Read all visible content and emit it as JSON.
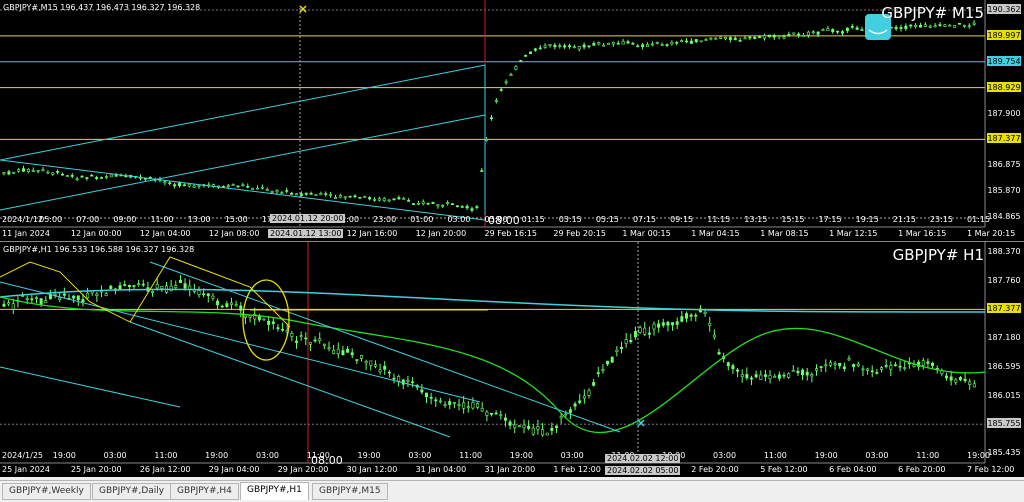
{
  "m15": {
    "info": "GBPJPY#,M15  196.437 196.473 196.327 196.328",
    "symbol": "GBPJPY# M15",
    "price_labels": [
      {
        "text": "190.362",
        "kind": "gray"
      },
      {
        "text": "189.997",
        "kind": "yellow"
      },
      {
        "text": "189.754",
        "kind": "cyan"
      },
      {
        "text": "188.929",
        "kind": "yellow"
      },
      {
        "text": "187.900",
        "kind": "plain"
      },
      {
        "text": "187.377",
        "kind": "yellow"
      },
      {
        "text": "186.875",
        "kind": "plain"
      },
      {
        "text": "185.870",
        "kind": "plain"
      },
      {
        "text": "184.865",
        "kind": "plain"
      }
    ],
    "time_labels": [
      "11 Jan 2024",
      "12 Jan 00:00",
      "12 Jan 04:00",
      "12 Jan 08:00",
      "12 Jan 12:00",
      "12 Jan 16:00",
      "12 Jan 20:00",
      "29 Feb 16:15",
      "29 Feb 20:15",
      "1 Mar 00:15",
      "1 Mar 04:15",
      "1 Mar 08:15",
      "1 Mar 12:15",
      "1 Mar 16:15",
      "1 Mar 20:15"
    ],
    "inner_labels": [
      "2024/1/12",
      "05:00",
      "07:00",
      "09:00",
      "11:00",
      "13:00",
      "15:00",
      "17:00",
      "19:00",
      "21:00",
      "23:00",
      "01:00",
      "03:00",
      "05:00",
      "01:15",
      "03:15",
      "05:15",
      "07:15",
      "09:15",
      "11:15",
      "13:15",
      "15:15",
      "17:15",
      "19:15",
      "21:15",
      "23:15",
      "01:15"
    ],
    "crosshair_top": "2024.01.12 20:00",
    "crosshair_bottom": "2024.01.12 13:00",
    "crosshair_time": "08:00"
  },
  "h1": {
    "info": "GBPJPY#,H1  196.533 196.588 196.327 196.328",
    "symbol": "GBPJPY# H1",
    "price_labels": [
      {
        "text": "188.370",
        "kind": "plain"
      },
      {
        "text": "187.760",
        "kind": "plain"
      },
      {
        "text": "187.377",
        "kind": "yellow"
      },
      {
        "text": "187.180",
        "kind": "plain"
      },
      {
        "text": "186.595",
        "kind": "plain"
      },
      {
        "text": "186.015",
        "kind": "plain"
      },
      {
        "text": "185.755",
        "kind": "gray"
      },
      {
        "text": "185.435",
        "kind": "plain"
      }
    ],
    "time_labels": [
      "25 Jan 2024",
      "25 Jan 20:00",
      "26 Jan 12:00",
      "29 Jan 04:00",
      "29 Jan 20:00",
      "30 Jan 12:00",
      "31 Jan 04:00",
      "31 Jan 20:00",
      "1 Feb 12:00",
      "2 Feb 05:00",
      "2 Feb 20:00",
      "5 Feb 12:00",
      "6 Feb 04:00",
      "6 Feb 20:00",
      "7 Feb 12:00"
    ],
    "inner_labels": [
      "2024/1/25",
      "19:00",
      "03:00",
      "11:00",
      "19:00",
      "03:00",
      "11:00",
      "19:00",
      "03:00",
      "11:00",
      "19:00",
      "03:00",
      "11:00",
      "19:00",
      "03:00",
      "11:00",
      "19:00",
      "03:00",
      "11:00",
      "19:00"
    ],
    "crosshair_top": "2024.02.02 12:00",
    "crosshair_bottom": "2024.02.02 05:00",
    "crosshair_time": "08:00"
  },
  "tabs": [
    "GBPJPY#,Weekly",
    "GBPJPY#,Daily",
    "GBPJPY#,H4",
    "GBPJPY#,H1",
    "GBPJPY#,M15"
  ],
  "active_tab": 3,
  "colors": {
    "yellow": "#e8e000",
    "cyan": "#40d0e0",
    "green": "#6cff6c",
    "lime": "#22dd22",
    "red": "#cc2222",
    "gray_label": "#c8c8c8"
  },
  "icons": {
    "alert_marker": "cross-icon"
  }
}
